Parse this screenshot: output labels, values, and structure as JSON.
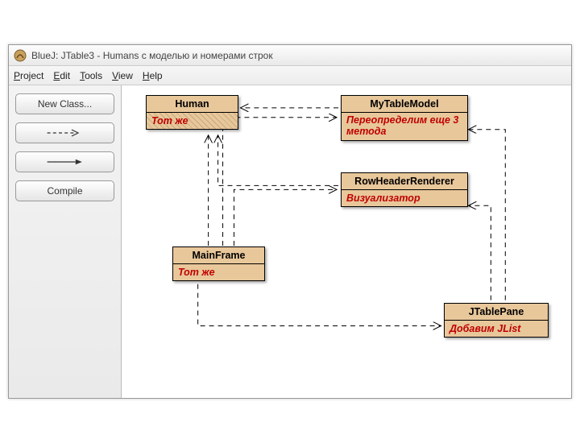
{
  "window": {
    "title": "BlueJ:  JTable3 - Humans с моделью и номерами строк"
  },
  "menu": {
    "project": "Project",
    "edit": "Edit",
    "tools": "Tools",
    "view": "View",
    "help": "Help"
  },
  "sidebar": {
    "new_class": "New Class...",
    "compile": "Compile"
  },
  "classes": {
    "human": {
      "name": "Human",
      "note": "Тот же"
    },
    "mytablemodel": {
      "name": "MyTableModel",
      "note": "Переопределим еще 3 метода"
    },
    "rowheaderrenderer": {
      "name": "RowHeaderRenderer",
      "note": "Визуализатор"
    },
    "mainframe": {
      "name": "MainFrame",
      "note": "Тот же"
    },
    "jtablepane": {
      "name": "JTablePane",
      "note": "Добавим JList"
    }
  },
  "chart_data": {
    "type": "table",
    "title": "UML class diagram — JTable3",
    "nodes": [
      {
        "id": "Human",
        "annotation": "Тот же"
      },
      {
        "id": "MyTableModel",
        "annotation": "Переопределим еще 3 метода"
      },
      {
        "id": "RowHeaderRenderer",
        "annotation": "Визуализатор"
      },
      {
        "id": "MainFrame",
        "annotation": "Тот же"
      },
      {
        "id": "JTablePane",
        "annotation": "Добавим JList"
      }
    ],
    "edges": [
      {
        "from": "MyTableModel",
        "to": "Human",
        "style": "dashed-arrow"
      },
      {
        "from": "RowHeaderRenderer",
        "to": "Human",
        "style": "dashed-arrow"
      },
      {
        "from": "MainFrame",
        "to": "Human",
        "style": "dashed-arrow"
      },
      {
        "from": "MainFrame",
        "to": "MyTableModel",
        "style": "dashed-arrow"
      },
      {
        "from": "MainFrame",
        "to": "RowHeaderRenderer",
        "style": "dashed-arrow"
      },
      {
        "from": "MainFrame",
        "to": "JTablePane",
        "style": "dashed-arrow"
      },
      {
        "from": "JTablePane",
        "to": "RowHeaderRenderer",
        "style": "dashed-arrow"
      },
      {
        "from": "JTablePane",
        "to": "MyTableModel",
        "style": "dashed-arrow"
      }
    ]
  }
}
